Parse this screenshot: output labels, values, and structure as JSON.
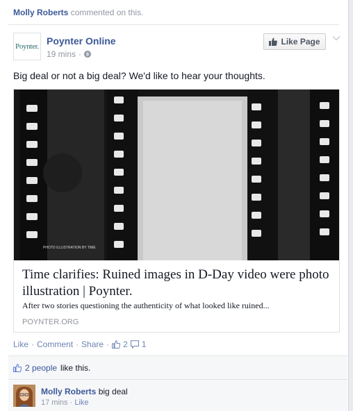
{
  "story": {
    "actor": "Molly Roberts",
    "action": "commented on this."
  },
  "post": {
    "page_name": "Poynter Online",
    "logo_text": "Poynter.",
    "time": "19 mins",
    "meta_sep": "·",
    "like_page_label": "Like Page",
    "text": "Big deal or not a big deal? We'd like to hear your thoughts."
  },
  "link": {
    "image_caption": "PHOTO ILLUSTRATION BY TIME",
    "title": "Time clarifies: Ruined images in D-Day video were photo illustration | Poynter.",
    "description": "After two stories questioning the authenticity of what looked like ruined...",
    "domain": "POYNTER.ORG"
  },
  "actions": {
    "like": "Like",
    "comment": "Comment",
    "share": "Share",
    "sep": "·",
    "like_count": "2",
    "comment_count": "1"
  },
  "feedback": {
    "likes_people": "2 people",
    "likes_suffix": "like this."
  },
  "comment": {
    "author": "Molly Roberts",
    "text": "big deal",
    "time": "17 mins",
    "sep": "·",
    "like": "Like"
  },
  "colors": {
    "link_blue": "#3b5998",
    "muted_gray": "#9197a3",
    "action_blue": "#6d84b4"
  }
}
